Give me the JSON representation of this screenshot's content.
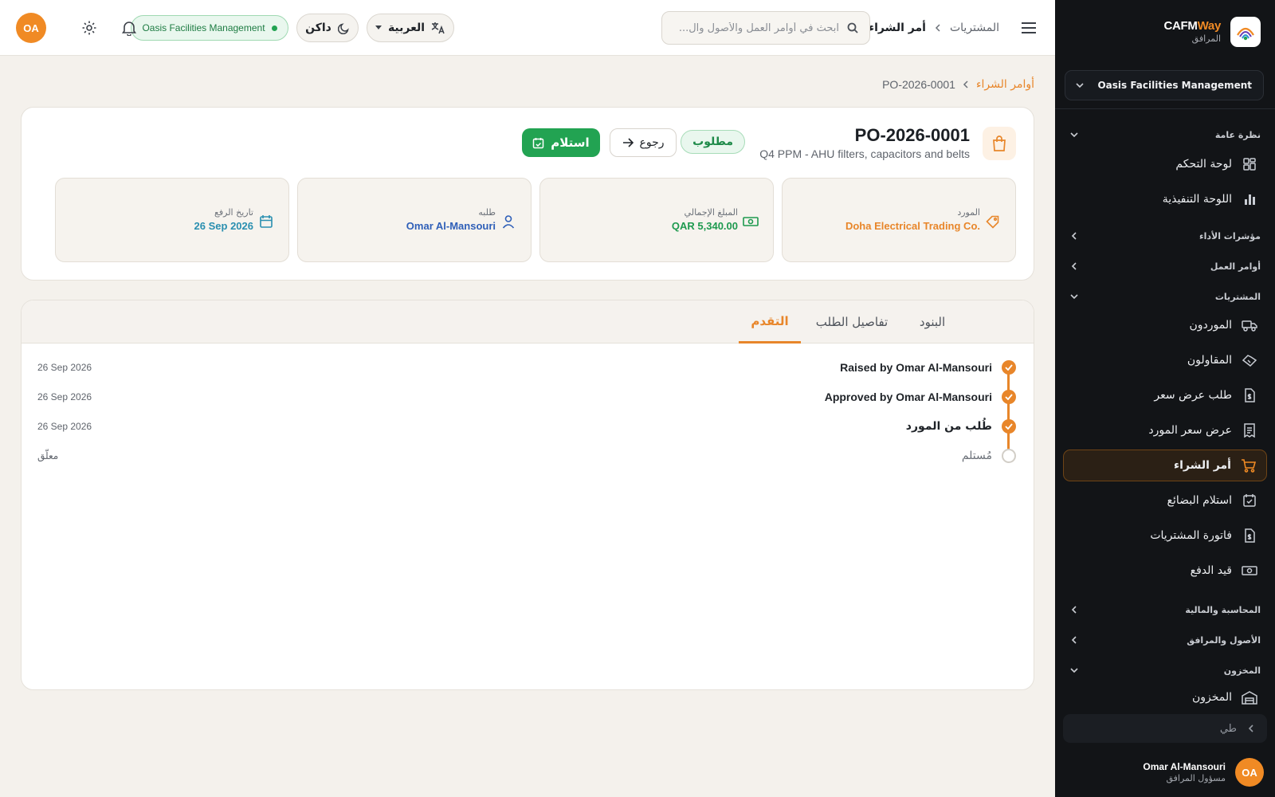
{
  "sidebar": {
    "brand": {
      "name_part1": "CAFM",
      "name_part2": "Way",
      "subtitle": "المرافق"
    },
    "org_selector": "Oasis Facilities Management",
    "sections": {
      "overview": "نظرة عامة",
      "kpis": "مؤشرات الأداء",
      "work_orders": "أوامر العمل",
      "procurement": "المشتريات",
      "accounting": "المحاسبة والمالية",
      "assets": "الأصول والمرافق",
      "inventory": "المخزون"
    },
    "items": {
      "dashboard": "لوحة التحكم",
      "executive": "اللوحة التنفيذية",
      "suppliers": "الموردون",
      "contractors": "المقاولون",
      "rfq": "طلب عرض سعر",
      "supplier_quote": "عرض سعر المورد",
      "purchase_order": "أمر الشراء",
      "goods_receipt": "استلام البضائع",
      "purchase_invoice": "فاتورة المشتريات",
      "payment_entry": "قيد الدفع",
      "stock": "المخزون"
    },
    "collapse_label": "طي",
    "user": {
      "initials": "OA",
      "name": "Omar Al-Mansouri",
      "role": "مسؤول المرافق"
    }
  },
  "topbar": {
    "breadcrumb_parent": "المشتريات",
    "breadcrumb_current": "أمر الشراء",
    "search_placeholder": "ابحث في أوامر العمل والأصول وال...",
    "language": "العربية",
    "theme": "داكن",
    "org_badge": "Oasis Facilities Management",
    "avatar_initials": "OA"
  },
  "page": {
    "breadcrumb_link": "أوامر الشراء",
    "breadcrumb_current": "PO-2026-0001",
    "title": "PO-2026-0001",
    "subtitle": "Q4 PPM - AHU filters, capacitors and belts",
    "status": "مطلوب",
    "back_label": "رجوع",
    "receive_label": "استلام",
    "stats": [
      {
        "label": "المورد",
        "value": "Doha Electrical Trading Co.",
        "color": "#e8862a"
      },
      {
        "label": "المبلغ الإجمالي",
        "value": "QAR 5,340.00",
        "color": "#1e9a4f"
      },
      {
        "label": "طلبه",
        "value": "Omar Al-Mansouri",
        "color": "#2f5fb8"
      },
      {
        "label": "تاريخ الرفع",
        "value": "26 Sep 2026",
        "color": "#2a8fb0"
      }
    ],
    "tabs": [
      "البنود",
      "تفاصيل الطلب",
      "التقدم"
    ],
    "active_tab": "التقدم",
    "timeline": [
      {
        "label": "Raised by Omar Al-Mansouri",
        "date": "26 Sep 2026",
        "done": true
      },
      {
        "label": "Approved by Omar Al-Mansouri",
        "date": "26 Sep 2026",
        "done": true
      },
      {
        "label": "طُلب من المورد",
        "date": "26 Sep 2026",
        "done": true
      },
      {
        "label": "مُستلم",
        "date": "معلّق",
        "done": false
      }
    ]
  },
  "colors": {
    "accent": "#e8862a",
    "success": "#22a352",
    "sidebar_bg": "#121417"
  }
}
